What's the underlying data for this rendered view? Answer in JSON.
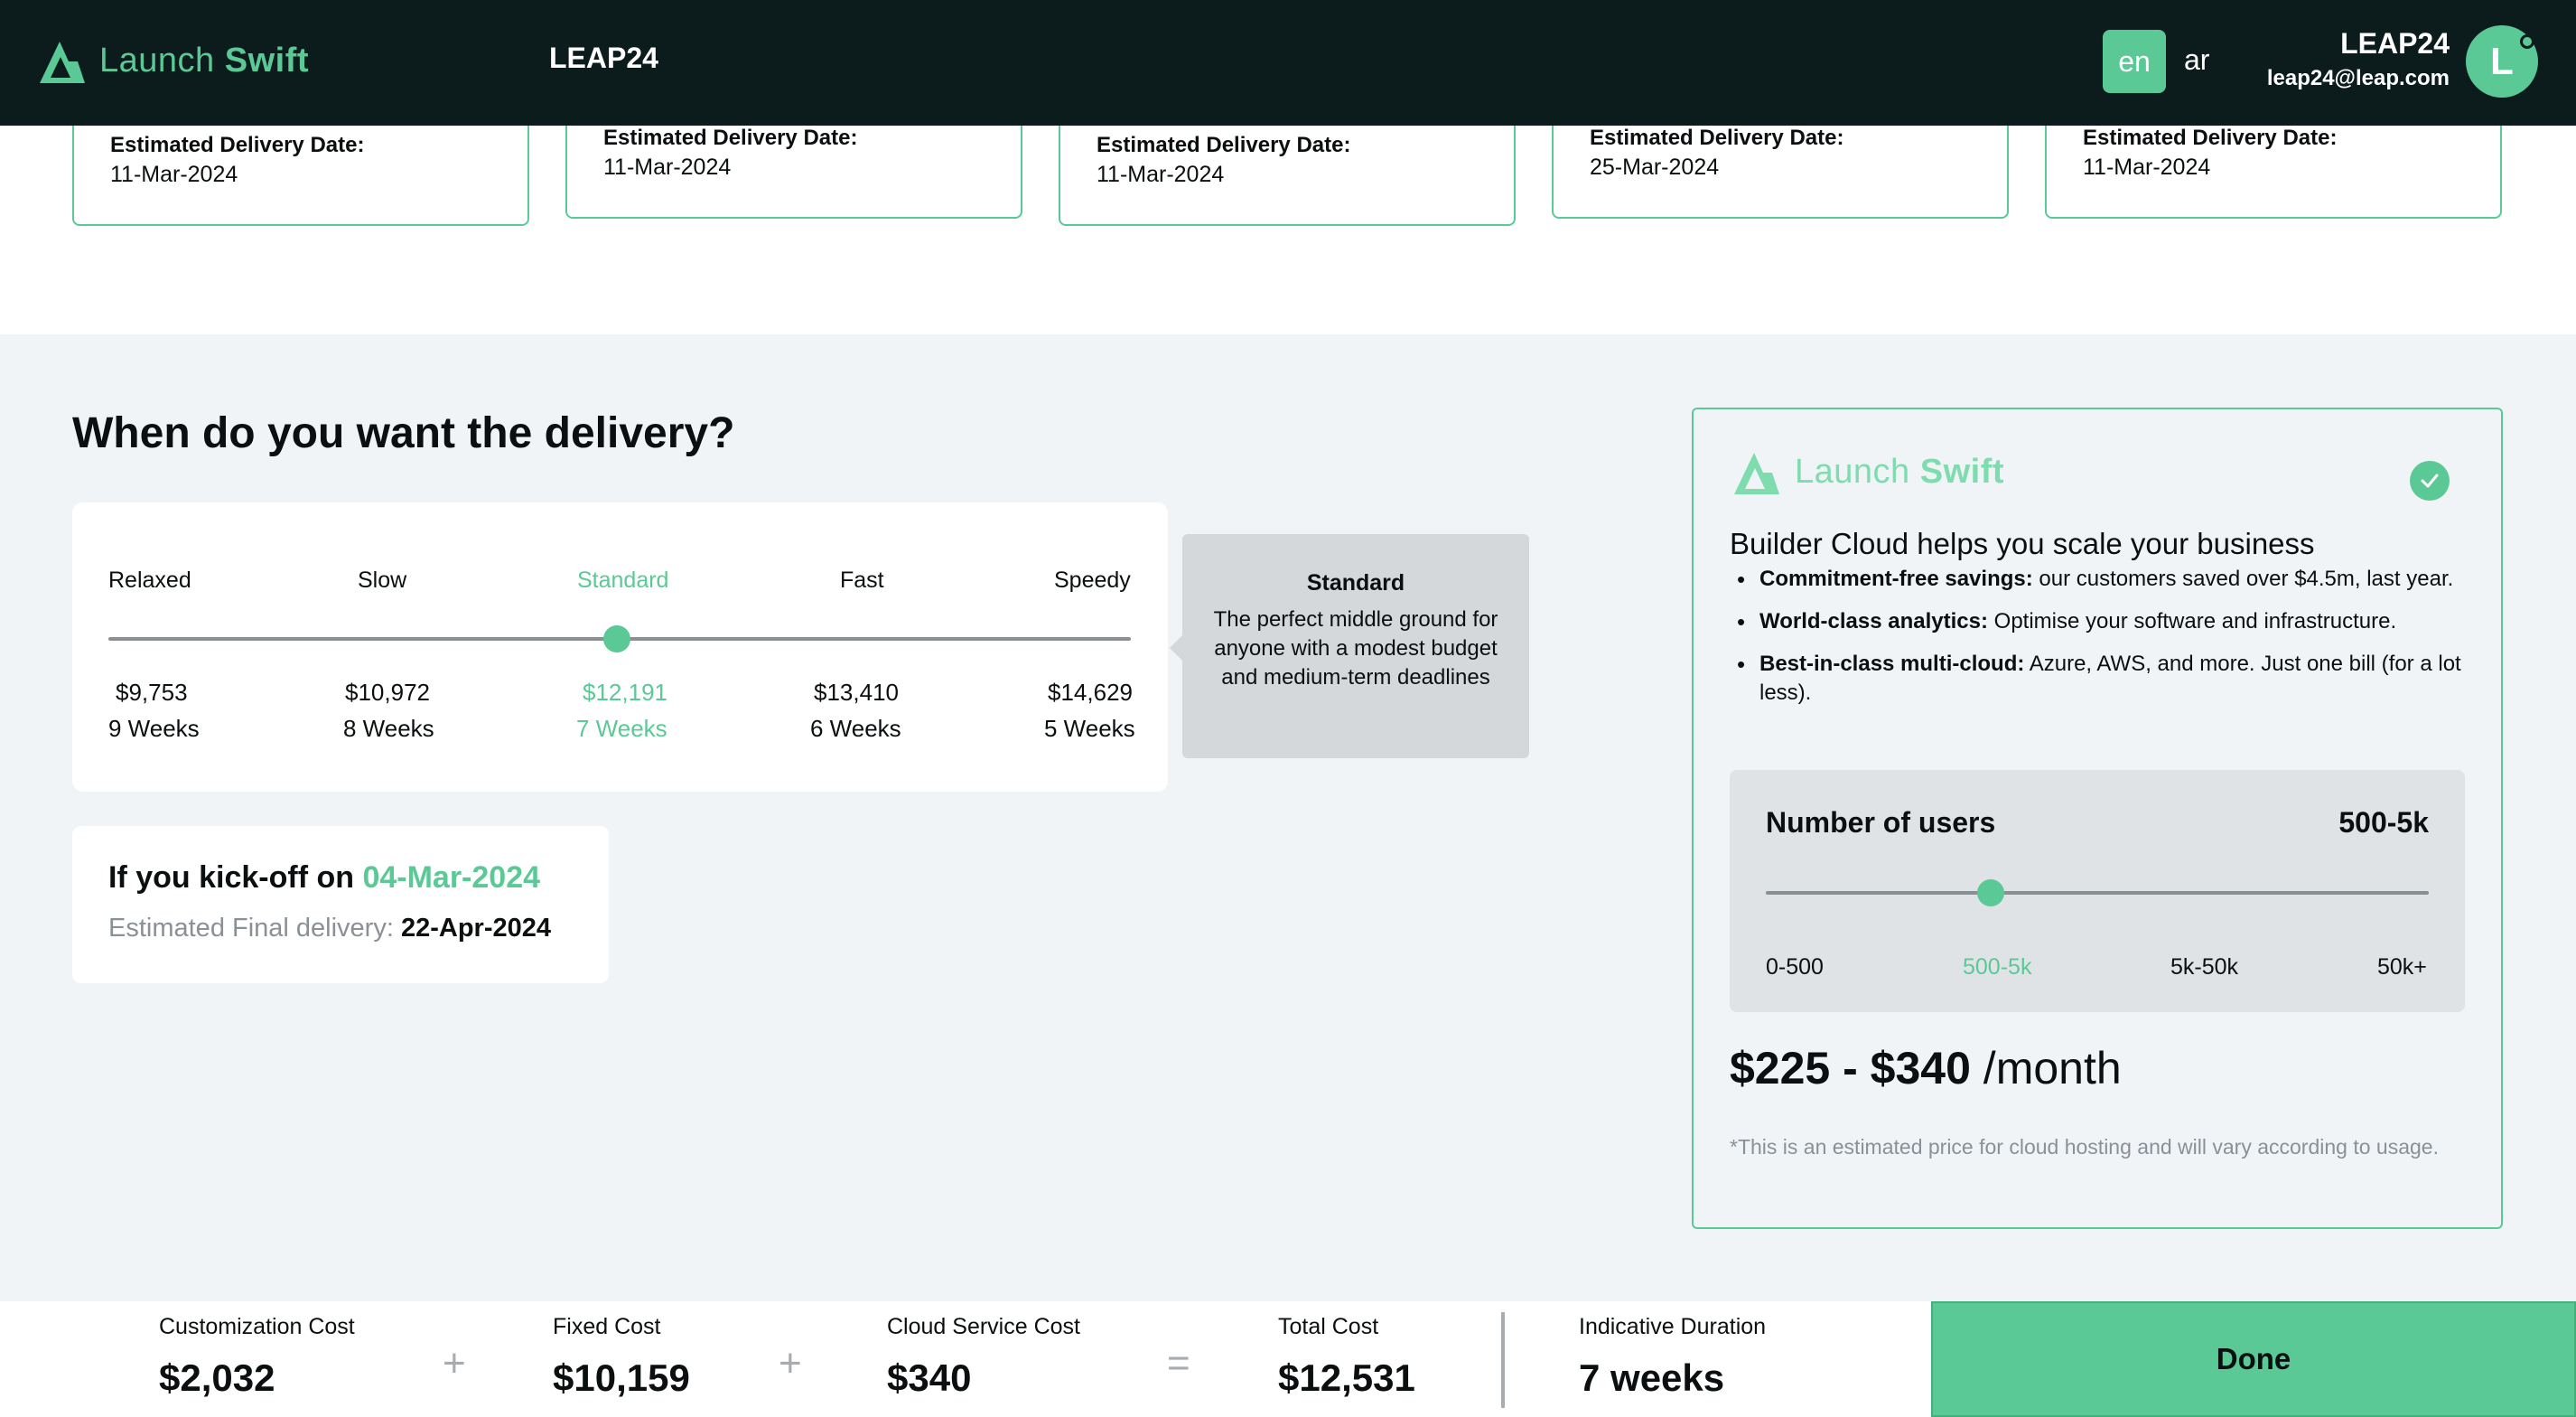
{
  "header": {
    "logo_text_light": "Launch",
    "logo_text_bold": "Swift",
    "org_name": "LEAP24",
    "lang_en": "en",
    "lang_ar": "ar",
    "user_name": "LEAP24",
    "user_email": "leap24@leap.com",
    "avatar_initial": "L"
  },
  "delivery_cards": [
    {
      "label": "Estimated Delivery Date:",
      "date": "11-Mar-2024"
    },
    {
      "label": "Estimated Delivery Date:",
      "date": "11-Mar-2024"
    },
    {
      "label": "Estimated Delivery Date:",
      "date": "11-Mar-2024"
    },
    {
      "label": "Estimated Delivery Date:",
      "date": "25-Mar-2024"
    },
    {
      "label": "Estimated Delivery Date:",
      "date": "11-Mar-2024"
    }
  ],
  "delivery": {
    "title": "When do you want the delivery?",
    "options": [
      {
        "name": "Relaxed",
        "price": "$9,753",
        "weeks": "9 Weeks"
      },
      {
        "name": "Slow",
        "price": "$10,972",
        "weeks": "8 Weeks"
      },
      {
        "name": "Standard",
        "price": "$12,191",
        "weeks": "7 Weeks"
      },
      {
        "name": "Fast",
        "price": "$13,410",
        "weeks": "6 Weeks"
      },
      {
        "name": "Speedy",
        "price": "$14,629",
        "weeks": "5 Weeks"
      }
    ],
    "selected_index": 2,
    "tooltip_title": "Standard",
    "tooltip_body": "The perfect middle ground for anyone with a modest budget and medium-term deadlines"
  },
  "kickoff": {
    "prefix": "If you kick-off on",
    "date": "04-Mar-2024",
    "final_label": "Estimated Final delivery:",
    "final_date": "22-Apr-2024"
  },
  "cloud": {
    "logo_text_light": "Launch",
    "logo_text_bold": "Swift",
    "heading": "Builder Cloud helps you scale your business",
    "bullets": [
      {
        "bold": "Commitment-free savings:",
        "text": " our customers saved over $4.5m, last year."
      },
      {
        "bold": "World-class analytics:",
        "text": " Optimise your software and infrastructure."
      },
      {
        "bold": "Best-in-class multi-cloud:",
        "text": " Azure, AWS, and more. Just one bill (for a lot less)."
      }
    ],
    "users_title": "Number of users",
    "users_value": "500-5k",
    "user_ticks": [
      "0-500",
      "500-5k",
      "5k-50k",
      "50k+"
    ],
    "selected_user_tick": 1,
    "price_amount": "$225 - $340",
    "price_unit": " /month",
    "note": "*This is an estimated price for cloud hosting and will vary according to usage."
  },
  "footer": {
    "customization_label": "Customization Cost",
    "customization_value": "$2,032",
    "fixed_label": "Fixed Cost",
    "fixed_value": "$10,159",
    "cloud_label": "Cloud Service Cost",
    "cloud_value": "$340",
    "total_label": "Total Cost",
    "total_value": "$12,531",
    "duration_label": "Indicative Duration",
    "duration_value": "7 weeks",
    "op_plus": "+",
    "op_equals": "=",
    "done_label": "Done"
  },
  "colors": {
    "accent": "#5bc996",
    "header_bg": "#0c1c1c",
    "page_bg": "#f1f4f7"
  }
}
